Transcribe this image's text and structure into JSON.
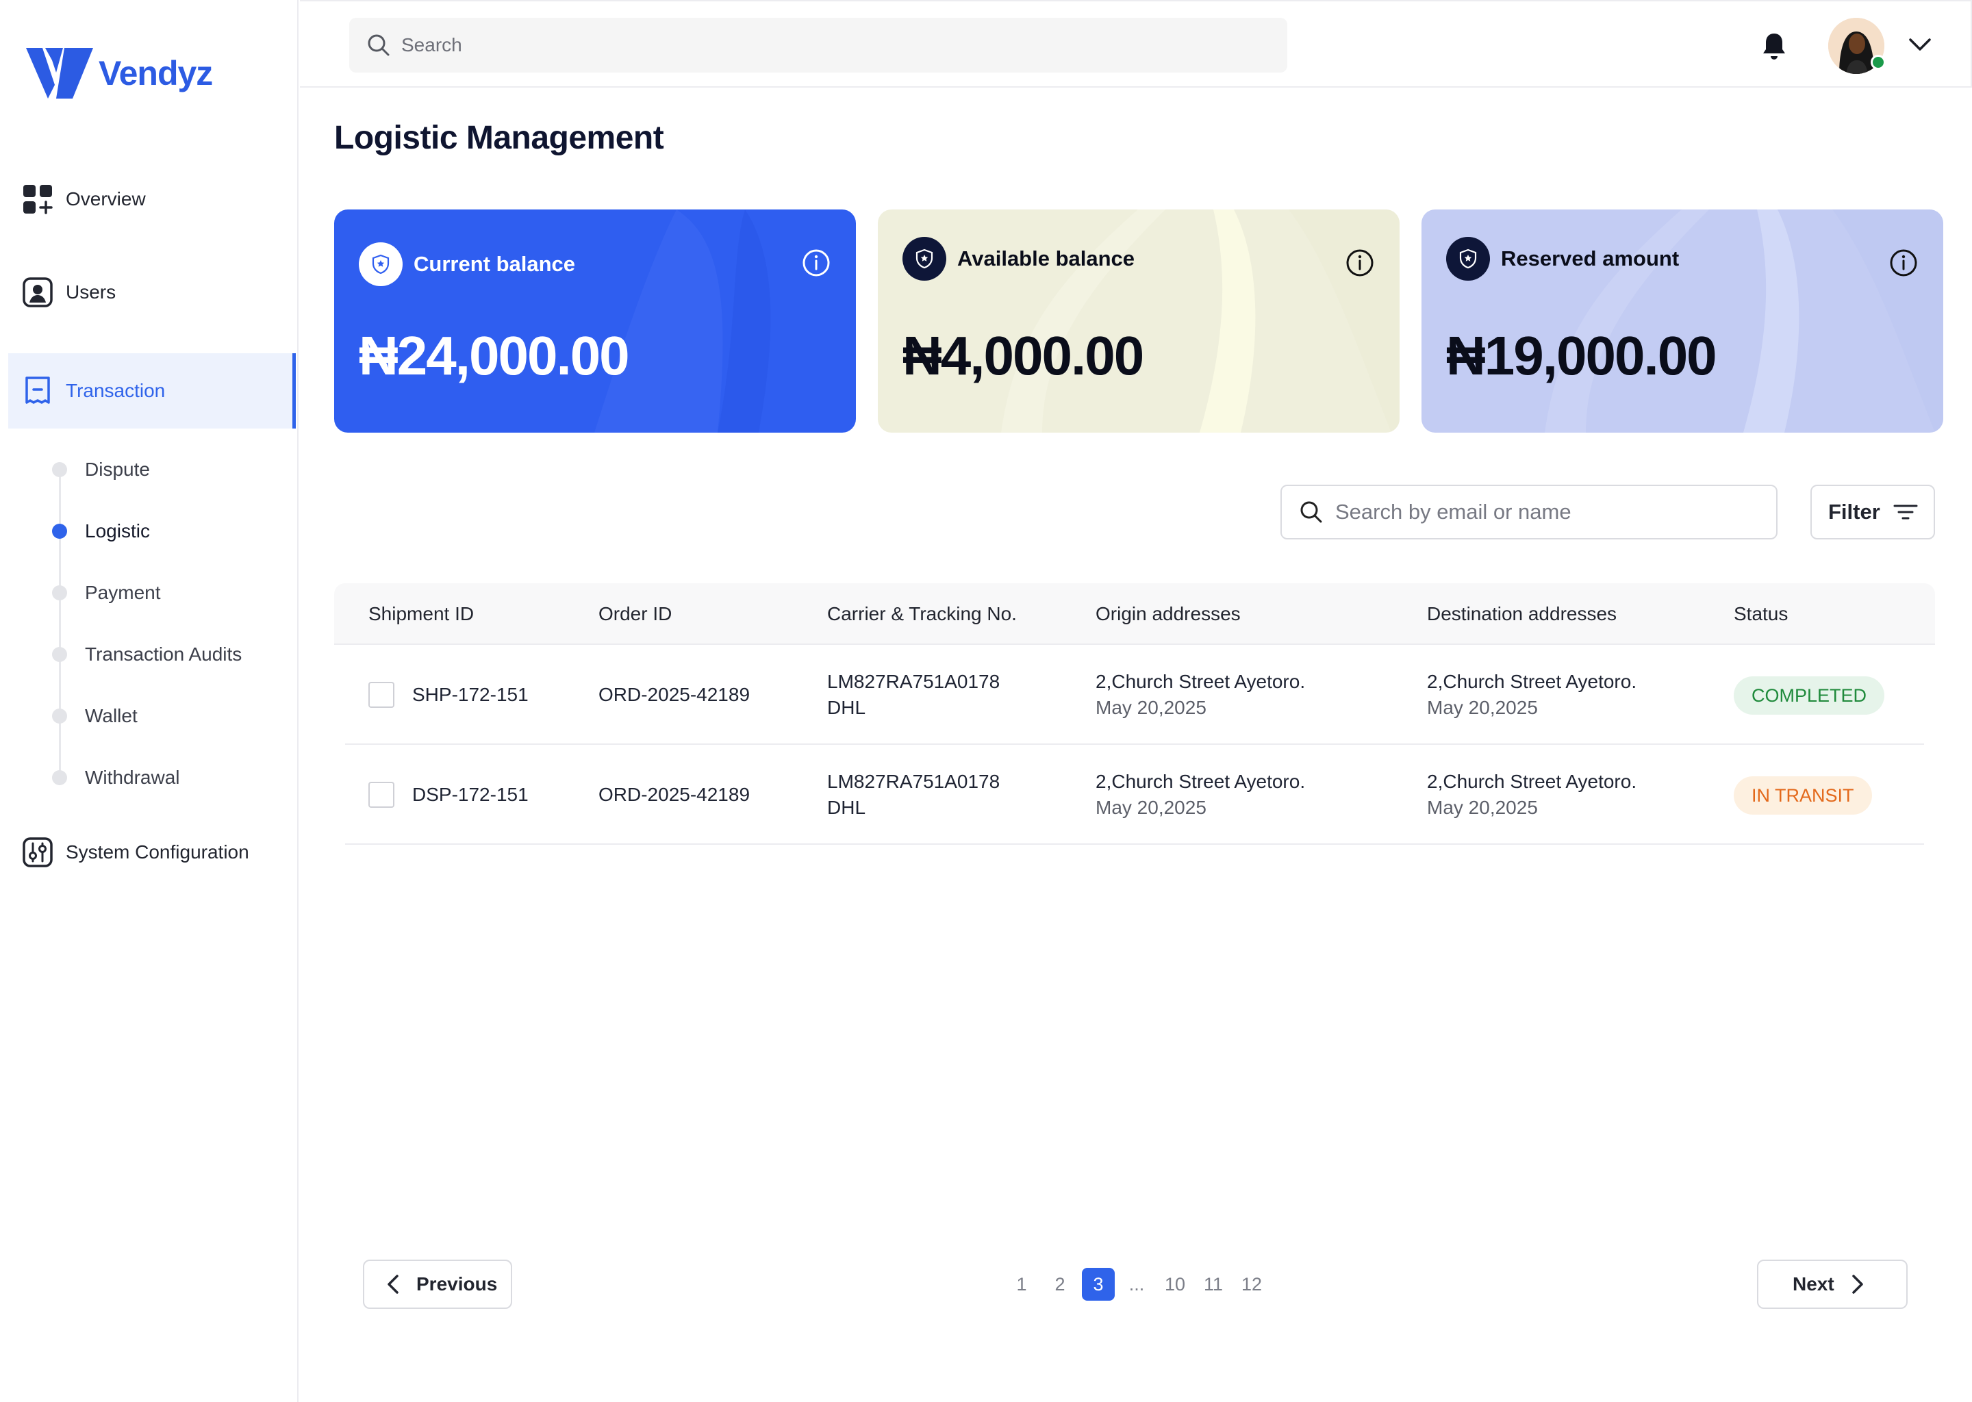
{
  "brand": {
    "name": "Vendyz",
    "color": "#2c5be3"
  },
  "header": {
    "search_placeholder": "Search",
    "notification_icon": "bell-icon",
    "profile_icon": "avatar"
  },
  "sidebar": {
    "items": [
      {
        "label": "Overview",
        "icon": "grid-icon"
      },
      {
        "label": "Users",
        "icon": "user-icon"
      },
      {
        "label": "Transaction",
        "icon": "receipt-icon",
        "active": true
      },
      {
        "label": "System Configuration",
        "icon": "sliders-icon"
      }
    ],
    "sub_items": [
      {
        "label": "Dispute"
      },
      {
        "label": "Logistic",
        "active": true
      },
      {
        "label": "Payment"
      },
      {
        "label": "Transaction Audits"
      },
      {
        "label": "Wallet"
      },
      {
        "label": "Withdrawal"
      }
    ]
  },
  "page": {
    "title": "Logistic Management"
  },
  "cards": [
    {
      "label": "Current balance",
      "amount": "₦24,000.00",
      "color": "#2f5ef0"
    },
    {
      "label": "Available balance",
      "amount": "₦4,000.00",
      "color": "#efefdc"
    },
    {
      "label": "Reserved amount",
      "amount": "₦19,000.00",
      "color": "#c3ccf3"
    }
  ],
  "table_tools": {
    "search_placeholder": "Search by email or name",
    "filter_label": "Filter"
  },
  "table": {
    "columns": [
      "Shipment ID",
      "Order ID",
      "Carrier & Tracking No.",
      "Origin addresses",
      "Destination addresses",
      "Status"
    ],
    "rows": [
      {
        "shipment_id": "SHP-172-151",
        "order_id": "ORD-2025-42189",
        "tracking": "LM827RA751A0178",
        "carrier": "DHL",
        "origin": "2,Church Street Ayetoro.",
        "origin_date": "May 20,2025",
        "destination": "2,Church Street Ayetoro.",
        "destination_date": "May 20,2025",
        "status": "COMPLETED"
      },
      {
        "shipment_id": "DSP-172-151",
        "order_id": "ORD-2025-42189",
        "tracking": "LM827RA751A0178",
        "carrier": "DHL",
        "origin": "2,Church Street Ayetoro.",
        "origin_date": "May 20,2025",
        "destination": "2,Church Street Ayetoro.",
        "destination_date": "May 20,2025",
        "status": "IN TRANSIT"
      }
    ]
  },
  "pagination": {
    "previous_label": "Previous",
    "next_label": "Next",
    "pages": [
      "1",
      "2",
      "3",
      "...",
      "10",
      "11",
      "12"
    ],
    "current": "3"
  },
  "colors": {
    "accent": "#2f63ea",
    "completed_bg": "#e6f4ea",
    "completed_text": "#1f8a3b",
    "transit_bg": "#fdf0e0",
    "transit_text": "#e3691b"
  }
}
